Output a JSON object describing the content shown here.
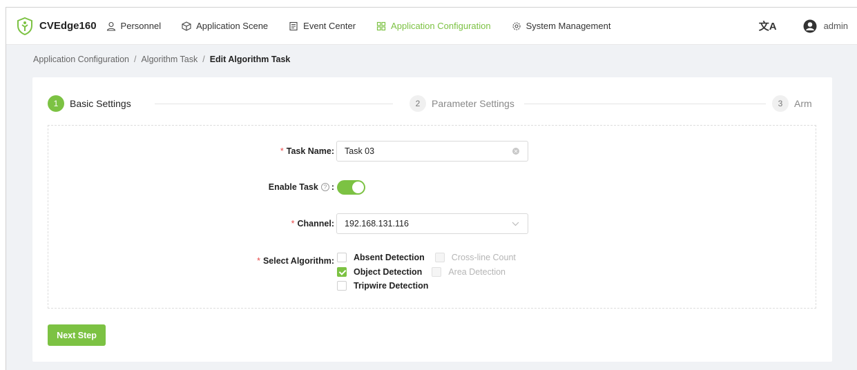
{
  "nav": {
    "brand": "CVEdge160",
    "items": [
      {
        "label": "Personnel",
        "icon": "person-icon"
      },
      {
        "label": "Application Scene",
        "icon": "cube-icon"
      },
      {
        "label": "Event Center",
        "icon": "document-icon"
      },
      {
        "label": "Application Configuration",
        "icon": "grid-icon",
        "active": true
      },
      {
        "label": "System Management",
        "icon": "gear-icon"
      }
    ],
    "language_icon": "文A",
    "user": "admin"
  },
  "breadcrumb": {
    "items": [
      "Application Configuration",
      "Algorithm Task"
    ],
    "current": "Edit Algorithm Task",
    "separator": "/"
  },
  "steps": [
    {
      "num": "1",
      "label": "Basic Settings",
      "state": "active"
    },
    {
      "num": "2",
      "label": "Parameter Settings",
      "state": "inactive"
    },
    {
      "num": "3",
      "label": "Arm",
      "state": "inactive"
    }
  ],
  "form": {
    "required_mark": "*",
    "task_name": {
      "label": "Task Name",
      "value": "Task 03"
    },
    "enable_task": {
      "label": "Enable Task",
      "enabled": true
    },
    "channel": {
      "label": "Channel",
      "value": "192.168.131.116"
    },
    "algorithm": {
      "label": "Select Algorithm",
      "options": [
        {
          "label": "Absent Detection",
          "checked": false,
          "disabled": false
        },
        {
          "label": "Cross-line Count",
          "checked": false,
          "disabled": true
        },
        {
          "label": "Object Detection",
          "checked": true,
          "disabled": false
        },
        {
          "label": "Area Detection",
          "checked": false,
          "disabled": true
        },
        {
          "label": "Tripwire Detection",
          "checked": false,
          "disabled": false
        }
      ]
    }
  },
  "next_button": "Next Step",
  "colors": {
    "accent": "#7cc243",
    "required": "#e84a4a"
  }
}
